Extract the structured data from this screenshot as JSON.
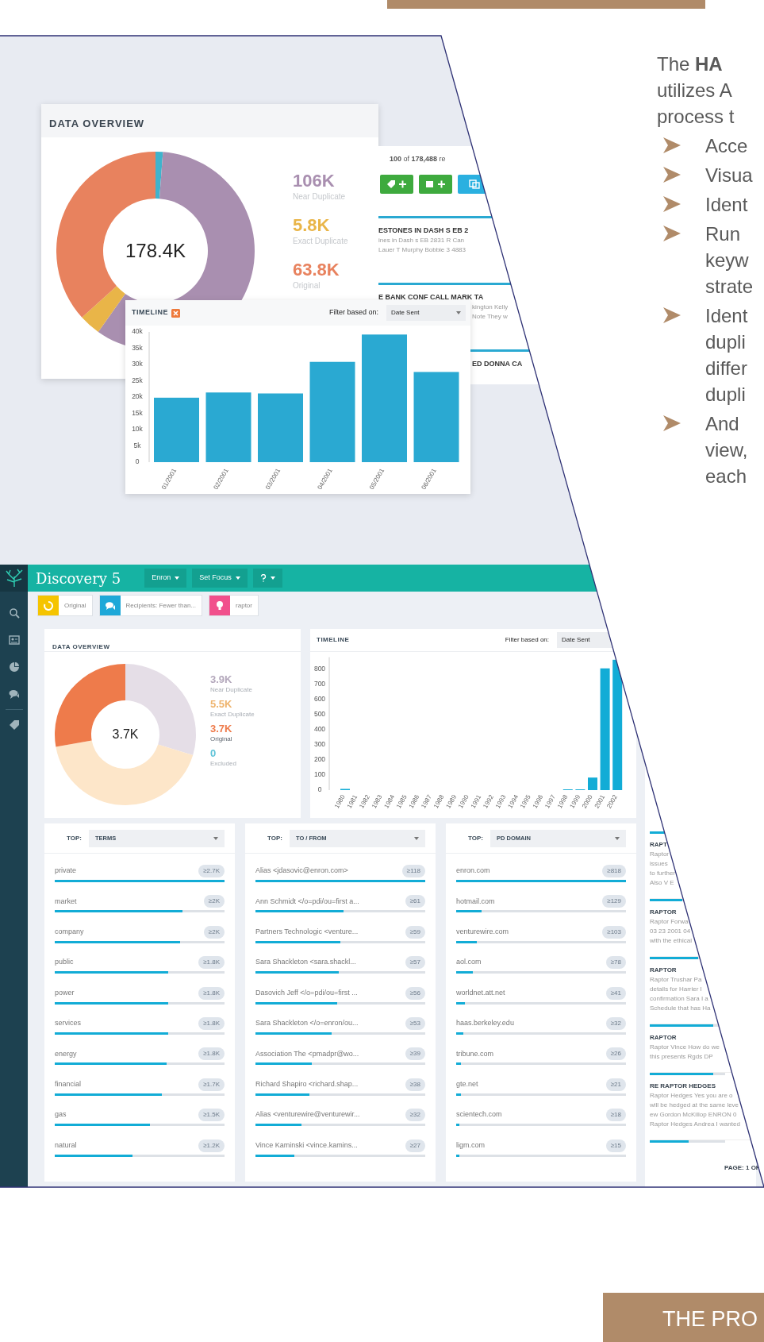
{
  "screenshot": {
    "overview_card": {
      "title": "DATA OVERVIEW",
      "total": "178.4K",
      "stats": [
        {
          "value": "106K",
          "label": "Near Duplicate",
          "color": "#a98fb0"
        },
        {
          "value": "5.8K",
          "label": "Exact Duplicate",
          "color": "#e9b548"
        },
        {
          "value": "63.8K",
          "label": "Original",
          "color": "#e8825e"
        }
      ]
    },
    "results_card": {
      "count": "**100** of **178,488** re",
      "buttons": [
        {
          "kind": "tag"
        },
        {
          "kind": "box"
        },
        {
          "kind": "copy"
        }
      ],
      "items": [
        {
          "title": "ESTONES IN DASH S EB 2",
          "lines": [
            "ines in Dash s EB 2831 R Can",
            "Lauer T Murphy Bobbie 3 4883"
          ],
          "title_covered": false,
          "lines_covered": false
        },
        {
          "title": "E BANK CONF CALL MARK TA",
          "lines": [
            "kington Kelly",
            "Note They w"
          ],
          "title_covered": false,
          "lines_covered": true
        },
        {
          "title": "ED DONNA CA",
          "title_covered": true
        }
      ]
    },
    "timeline_card": {
      "title": "TIMELINE",
      "filter_label": "Filter based on:",
      "filter_value": "Date Sent",
      "chart_data": {
        "type": "bar",
        "categories": [
          "01/2001",
          "02/2001",
          "03/2001",
          "04/2001",
          "05/2001",
          "06/2001"
        ],
        "values": [
          19800,
          21400,
          21100,
          30800,
          39200,
          27700
        ],
        "ylim": [
          0,
          40000
        ],
        "yticks": [
          {
            "value": 0,
            "label": "0"
          },
          {
            "value": 5000,
            "label": "5k"
          },
          {
            "value": 10000,
            "label": "10k"
          },
          {
            "value": 15000,
            "label": "15k"
          },
          {
            "value": 20000,
            "label": "20k"
          },
          {
            "value": 25000,
            "label": "25k"
          },
          {
            "value": 30000,
            "label": "30k"
          },
          {
            "value": 35000,
            "label": "35k"
          },
          {
            "value": 40000,
            "label": "40k"
          }
        ]
      }
    }
  },
  "dashboard": {
    "app_title": "Discovery 5",
    "menus": [
      {
        "kind": "text",
        "label": "Enron"
      },
      {
        "kind": "text",
        "label": "Set Focus"
      },
      {
        "kind": "icon"
      }
    ],
    "chips": [
      {
        "kind": "circle",
        "label": "Original",
        "color": "#f5c400"
      },
      {
        "kind": "chat",
        "label": "Recipients: Fewer than...",
        "color": "#1ea8d8"
      },
      {
        "kind": "bulb",
        "label": "raptor",
        "color": "#f1508c"
      }
    ],
    "overview": {
      "title": "DATA OVERVIEW",
      "total": "3.7K",
      "stats": [
        {
          "value": "3.9K",
          "label": "Near Duplicate",
          "color": "#b4a8bc",
          "dimmed": true
        },
        {
          "value": "5.5K",
          "label": "Exact Duplicate",
          "color": "#eeb46e",
          "dimmed": true
        },
        {
          "value": "3.7K",
          "label": "Original",
          "color": "#ee7b4b",
          "dimmed": false
        },
        {
          "value": "0",
          "label": "Excluded",
          "color": "#5fc3d8",
          "dimmed": true
        }
      ]
    },
    "timeline": {
      "title": "TIMELINE",
      "filter_label": "Filter based on:",
      "filter_value": "Date Sent",
      "chart_data": {
        "type": "bar",
        "categories": [
          "1980",
          "1981",
          "1982",
          "1983",
          "1984",
          "1985",
          "1986",
          "1987",
          "1988",
          "1989",
          "1990",
          "1991",
          "1992",
          "1993",
          "1994",
          "1995",
          "1996",
          "1997",
          "1998",
          "1999",
          "2000",
          "2001",
          "2002"
        ],
        "values": [
          8,
          0,
          0,
          0,
          0,
          0,
          0,
          0,
          0,
          0,
          0,
          0,
          0,
          0,
          0,
          0,
          0,
          0,
          5,
          5,
          83,
          806,
          863
        ],
        "ylim": [
          0,
          880
        ],
        "yticks": [
          0,
          100,
          200,
          300,
          400,
          500,
          600,
          700,
          800
        ]
      }
    },
    "top_lists": [
      {
        "prefix": "TOP:",
        "selector": "TERMS",
        "rows": [
          {
            "label": "private",
            "count": "≥2.7K",
            "level": 1.0
          },
          {
            "label": "market",
            "count": "≥2K",
            "level": 0.75
          },
          {
            "label": "company",
            "count": "≥2K",
            "level": 0.74
          },
          {
            "label": "public",
            "count": "≥1.8K",
            "level": 0.67
          },
          {
            "label": "power",
            "count": "≥1.8K",
            "level": 0.67
          },
          {
            "label": "services",
            "count": "≥1.8K",
            "level": 0.67
          },
          {
            "label": "energy",
            "count": "≥1.8K",
            "level": 0.66
          },
          {
            "label": "financial",
            "count": "≥1.7K",
            "level": 0.63
          },
          {
            "label": "gas",
            "count": "≥1.5K",
            "level": 0.56
          },
          {
            "label": "natural",
            "count": "≥1.2K",
            "level": 0.46
          }
        ]
      },
      {
        "prefix": "TOP:",
        "selector": "TO / FROM",
        "rows": [
          {
            "label": "Alias <jdasovic@enron.com>",
            "count": "≥118",
            "level": 1.0
          },
          {
            "label": "Ann Schmidt </o=pdi/ou=first a...",
            "count": "≥61",
            "level": 0.52
          },
          {
            "label": "Partners Technologic <venture...",
            "count": "≥59",
            "level": 0.5
          },
          {
            "label": "Sara Shackleton <sara.shackl...",
            "count": "≥57",
            "level": 0.49
          },
          {
            "label": "Dasovich Jeff </o=pdi/ou=first ...",
            "count": "≥56",
            "level": 0.48
          },
          {
            "label": "Sara Shackleton </o=enron/ou...",
            "count": "≥53",
            "level": 0.45
          },
          {
            "label": "Association The <pmadpr@wo...",
            "count": "≥39",
            "level": 0.33
          },
          {
            "label": "Richard Shapiro <richard.shap...",
            "count": "≥38",
            "level": 0.32
          },
          {
            "label": "Alias <venturewire@venturewir...",
            "count": "≥32",
            "level": 0.27
          },
          {
            "label": "Vince Kaminski <vince.kamins...",
            "count": "≥27",
            "level": 0.23
          }
        ]
      },
      {
        "prefix": "TOP:",
        "selector": "PD DOMAIN",
        "rows": [
          {
            "label": "enron.com",
            "count": "≥818",
            "level": 1.0
          },
          {
            "label": "hotmail.com",
            "count": "≥129",
            "level": 0.15
          },
          {
            "label": "venturewire.com",
            "count": "≥103",
            "level": 0.12
          },
          {
            "label": "aol.com",
            "count": "≥78",
            "level": 0.1
          },
          {
            "label": "worldnet.att.net",
            "count": "≥41",
            "level": 0.05
          },
          {
            "label": "haas.berkeley.edu",
            "count": "≥32",
            "level": 0.04
          },
          {
            "label": "tribune.com",
            "count": "≥26",
            "level": 0.03
          },
          {
            "label": "gte.net",
            "count": "≥21",
            "level": 0.03
          },
          {
            "label": "scientech.com",
            "count": "≥18",
            "level": 0.02
          },
          {
            "label": "ligm.com",
            "count": "≥15",
            "level": 0.02
          }
        ]
      }
    ],
    "results": {
      "items": [
        {
          "title": "RAPT",
          "lines": [
            "Raptor",
            "issues",
            "to further",
            "Also V E"
          ],
          "level": 0.22
        },
        {
          "title": "RAPTOR",
          "lines": [
            "Raptor Forwa",
            "03 23 2001 04",
            "with the ethical"
          ],
          "level": 0.43
        },
        {
          "title": "RAPTOR",
          "lines": [
            "Raptor Trushar Pa",
            "details for Harrier I",
            "confirmation Sara I a",
            "Schedule that has Ha"
          ],
          "level": 0.64
        },
        {
          "title": "RAPTOR",
          "lines": [
            "Raptor Vince How do we",
            "this presents Rgds DP"
          ],
          "level": 0.84
        },
        {
          "title": "RE RAPTOR HEDGES",
          "lines": [
            "Raptor Hedges Yes you are o",
            "will be hedged at the same leve",
            "ew Gordon McKillop ENRON 0",
            "Raptor Hedges Andrea I wanted"
          ],
          "level": 0.84
        },
        {
          "level": 0.52
        }
      ],
      "pager": "PAGE: 1 OF"
    }
  },
  "text_column": {
    "intro_lines": [
      "The **HA**",
      "utilizes A",
      "process t"
    ],
    "bullets": [
      {
        "lines": [
          "Acce"
        ]
      },
      {
        "lines": [
          "Visua"
        ]
      },
      {
        "lines": [
          "Ident"
        ]
      },
      {
        "lines": [
          "Run",
          "keyw",
          "strate"
        ]
      },
      {
        "lines": [
          "Ident",
          "dupli",
          "differ",
          "dupli"
        ]
      },
      {
        "lines": [
          "And",
          "view,",
          "each"
        ]
      }
    ]
  },
  "banner": {
    "text": "THE PRO"
  }
}
